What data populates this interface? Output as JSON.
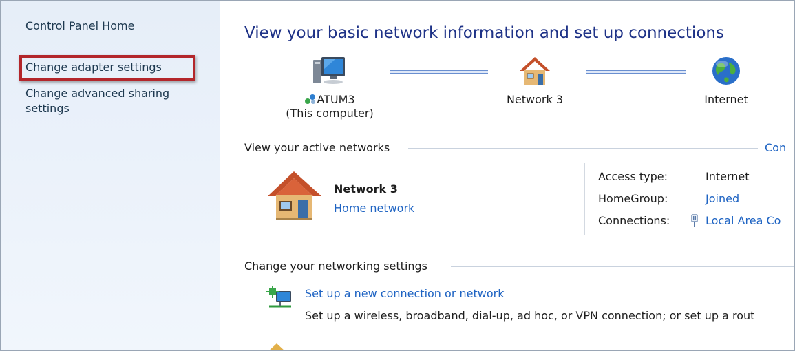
{
  "sidebar": {
    "home": "Control Panel Home",
    "adapter": "Change adapter settings",
    "sharing": "Change advanced sharing settings"
  },
  "main": {
    "title": "View your basic network information and set up connections",
    "map": {
      "computer_name": "ATUM3",
      "computer_sub": "(This computer)",
      "network": "Network 3",
      "internet": "Internet"
    },
    "active": {
      "heading": "View your active networks",
      "right_link": "Con",
      "network_name": "Network 3",
      "network_type": "Home network",
      "props": {
        "access_key": "Access type:",
        "access_val": "Internet",
        "homegroup_key": "HomeGroup:",
        "homegroup_val": "Joined",
        "connections_key": "Connections:",
        "connections_val": "Local Area Co"
      }
    },
    "settings": {
      "heading": "Change your networking settings",
      "task1_title": "Set up a new connection or network",
      "task1_desc": "Set up a wireless, broadband, dial-up, ad hoc, or VPN connection; or set up a rout"
    }
  },
  "colors": {
    "link": "#1f64c3",
    "title": "#1e3287",
    "highlight": "#b3262b",
    "sidebar_bg": "#e6eef8"
  },
  "icons": [
    "computer-icon",
    "network-badge-icon",
    "house-icon",
    "globe-icon",
    "cable-icon",
    "new-connection-icon"
  ]
}
